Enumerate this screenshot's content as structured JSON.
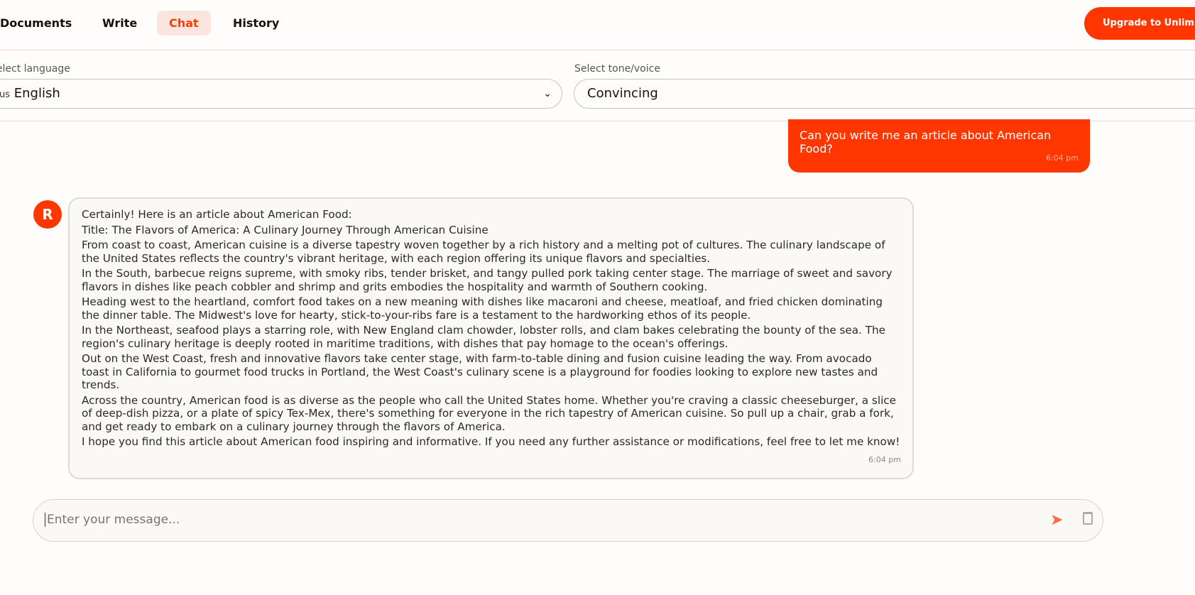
{
  "nav": {
    "tabs": [
      {
        "label": "Documents"
      },
      {
        "label": "Write"
      },
      {
        "label": "Chat",
        "active": true
      },
      {
        "label": "History"
      }
    ],
    "upgrade_label": "Upgrade to Unlimited"
  },
  "settings": {
    "language_label": "Select language",
    "language_flag": "us",
    "language_value": "English",
    "tone_label": "Select tone/voice",
    "tone_value": "Convincing"
  },
  "colors": {
    "accent": "#ff3600",
    "active_tab_bg": "#fde5df"
  },
  "chat": {
    "user_message": {
      "text": "Can you write me an article about American Food?",
      "time": "6:04 pm"
    },
    "bot_avatar": "R",
    "bot_message": {
      "paragraphs": [
        "Certainly! Here is an article about American Food:",
        "Title: The Flavors of America: A Culinary Journey Through American Cuisine",
        "From coast to coast, American cuisine is a diverse tapestry woven together by a rich history and a melting pot of cultures. The culinary landscape of the United States reflects the country's vibrant heritage, with each region offering its unique flavors and specialties.",
        "In the South, barbecue reigns supreme, with smoky ribs, tender brisket, and tangy pulled pork taking center stage. The marriage of sweet and savory flavors in dishes like peach cobbler and shrimp and grits embodies the hospitality and warmth of Southern cooking.",
        "Heading west to the heartland, comfort food takes on a new meaning with dishes like macaroni and cheese, meatloaf, and fried chicken dominating the dinner table. The Midwest's love for hearty, stick-to-your-ribs fare is a testament to the hardworking ethos of its people.",
        "In the Northeast, seafood plays a starring role, with New England clam chowder, lobster rolls, and clam bakes celebrating the bounty of the sea. The region's culinary heritage is deeply rooted in maritime traditions, with dishes that pay homage to the ocean's offerings.",
        "Out on the West Coast, fresh and innovative flavors take center stage, with farm-to-table dining and fusion cuisine leading the way. From avocado toast in California to gourmet food trucks in Portland, the West Coast's culinary scene is a playground for foodies looking to explore new tastes and trends.",
        "Across the country, American food is as diverse as the people who call the United States home. Whether you're craving a classic cheeseburger, a slice of deep-dish pizza, or a plate of spicy Tex-Mex, there's something for everyone in the rich tapestry of American cuisine. So pull up a chair, grab a fork, and get ready to embark on a culinary journey through the flavors of America.",
        "I hope you find this article about American food inspiring and informative. If you need any further assistance or modifications, feel free to let me know!"
      ],
      "time": "6:04 pm"
    },
    "input_placeholder": "Enter your message...",
    "icons": {
      "send": "send-icon",
      "clear": "trash-icon"
    }
  }
}
